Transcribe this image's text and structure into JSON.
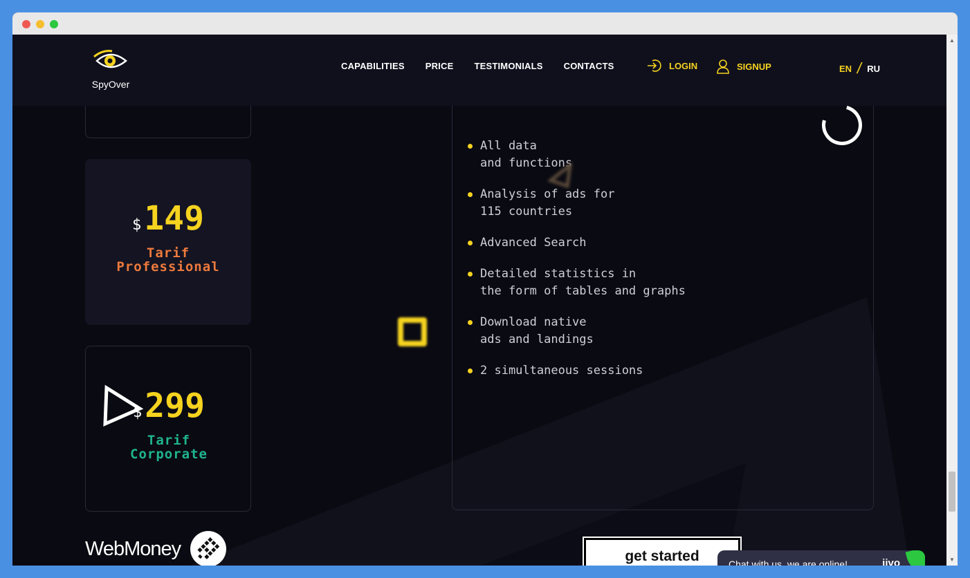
{
  "brand": {
    "name": "SpyOver"
  },
  "nav": [
    "CAPABILITIES",
    "PRICE",
    "TESTIMONIALS",
    "CONTACTS"
  ],
  "auth": {
    "login": "LOGIN",
    "signup": "SIGNUP"
  },
  "lang": {
    "en": "EN",
    "sep": "/",
    "ru": "RU"
  },
  "plans": [
    {
      "currency": "$",
      "price": "149",
      "name_line1": "Tarif",
      "name_line2": "Professional",
      "color": "#ee7a3c"
    },
    {
      "currency": "$",
      "price": "299",
      "name_line1": "Tarif",
      "name_line2": "Corporate",
      "color": "#1fb58f"
    }
  ],
  "features": [
    {
      "line1": "All data",
      "line2": "and functions"
    },
    {
      "line1": "Analysis of ads for",
      "line2": "115 countries"
    },
    {
      "line1": "Advanced Search",
      "line2": ""
    },
    {
      "line1": "Detailed statistics in",
      "line2": "the form of tables and graphs"
    },
    {
      "line1": "Download native",
      "line2": "ads and landings"
    },
    {
      "line1": "2 simultaneous sessions",
      "line2": ""
    }
  ],
  "payment": {
    "label": "WebMoney"
  },
  "cta": {
    "label": "get started"
  },
  "chat": {
    "message": "Chat with us, we are online!",
    "brand": "jivo"
  },
  "colors": {
    "accent": "#f5d31f",
    "background": "#0a0a12",
    "header": "#10101d"
  }
}
